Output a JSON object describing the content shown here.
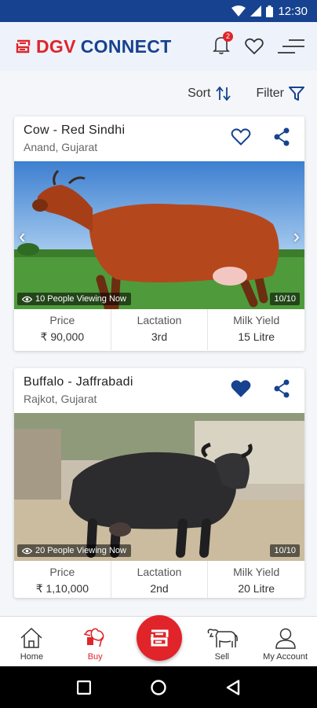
{
  "statusbar": {
    "time": "12:30"
  },
  "app": {
    "brand_red": "DGV",
    "brand_blue": "CONNECT",
    "notification_count": "2"
  },
  "colors": {
    "brand_blue": "#17428f",
    "brand_red": "#e0242a"
  },
  "toolbar": {
    "sort_label": "Sort",
    "filter_label": "Filter"
  },
  "listings": [
    {
      "title": "Cow - Red Sindhi",
      "location": "Anand, Gujarat",
      "favorited": false,
      "viewing": "10 People Viewing Now",
      "counter": "10/10",
      "stats": [
        {
          "label": "Price",
          "value": "₹ 90,000"
        },
        {
          "label": "Lactation",
          "value": "3rd"
        },
        {
          "label": "Milk Yield",
          "value": "15 Litre"
        }
      ]
    },
    {
      "title": "Buffalo - Jaffrabadi",
      "location": "Rajkot, Gujarat",
      "favorited": true,
      "viewing": "20 People Viewing Now",
      "counter": "10/10",
      "stats": [
        {
          "label": "Price",
          "value": "₹ 1,10,000"
        },
        {
          "label": "Lactation",
          "value": "2nd"
        },
        {
          "label": "Milk Yield",
          "value": "20 Litre"
        }
      ]
    }
  ],
  "bottom_nav": [
    {
      "label": "Home",
      "icon": "home-icon"
    },
    {
      "label": "Buy",
      "icon": "buy-icon",
      "active": true
    },
    {
      "label": "",
      "icon": "dgv-logo-icon"
    },
    {
      "label": "Sell",
      "icon": "cow-icon"
    },
    {
      "label": "My Account",
      "icon": "account-icon"
    }
  ]
}
